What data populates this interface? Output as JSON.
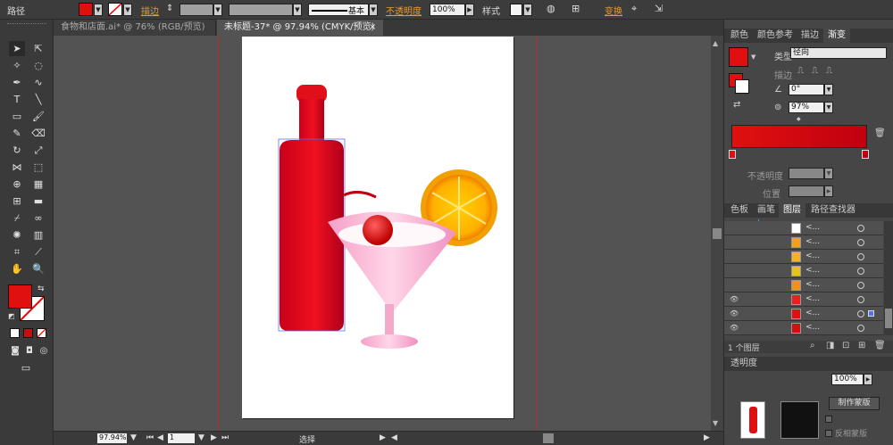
{
  "control_bar": {
    "selection_label": "路径",
    "fill_color": "#e01010",
    "stroke_label": "描边",
    "stroke_profile": "基本",
    "opacity_label": "不透明度",
    "opacity_value": "100%",
    "style_label": "样式",
    "transform_label": "变换"
  },
  "tabs": [
    {
      "label": "食物和店面.ai* @ 76% (RGB/预览)"
    },
    {
      "label": "未标题-37* @ 97.94% (CMYK/预览)"
    }
  ],
  "status": {
    "zoom": "97.94%",
    "page": "1",
    "mode": "选择"
  },
  "gradient_panel": {
    "tabs": [
      "颜色",
      "颜色参考",
      "描边",
      "渐变"
    ],
    "type_label": "类型",
    "type_value": "径向",
    "stroke_label": "描边",
    "angle_value": "0°",
    "aspect_value": "97%",
    "opacity_label": "不透明度",
    "location_label": "位置",
    "start_color": "#e01010",
    "end_color": "#c00010"
  },
  "layers_panel": {
    "tabs": [
      "色板",
      "画笔",
      "图层",
      "路径查找器"
    ],
    "footer": "1 个图层",
    "rows": [
      {
        "name": "<...",
        "thumb": "#ffffff",
        "eye": ""
      },
      {
        "name": "<...",
        "thumb": "#f0a020",
        "eye": ""
      },
      {
        "name": "<...",
        "thumb": "#f5b030",
        "eye": ""
      },
      {
        "name": "<...",
        "thumb": "#e8c020",
        "eye": ""
      },
      {
        "name": "<...",
        "thumb": "#f09020",
        "eye": ""
      },
      {
        "name": "<...",
        "thumb": "#e82020",
        "eye": "👁"
      },
      {
        "name": "<...",
        "thumb": "#e01010",
        "eye": "👁"
      },
      {
        "name": "<...",
        "thumb": "#d01010",
        "eye": "👁"
      }
    ]
  },
  "transparency_panel": {
    "title": "透明度",
    "opacity_value": "100%",
    "make_mask_label": "制作蒙版",
    "invert_mask_label": "反相蒙版"
  }
}
